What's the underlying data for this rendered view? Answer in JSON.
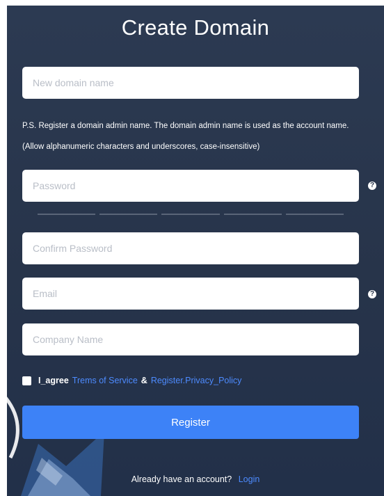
{
  "title": "Create Domain",
  "domain_field": {
    "placeholder": "New domain name"
  },
  "hint_text": "P.S. Register a domain admin name. The domain admin name is used as the account name.(Allow alphanumeric characters and underscores, case-insensitive)",
  "password_field": {
    "placeholder": "Password",
    "help_glyph": "?"
  },
  "password_strength": {
    "segments": 5
  },
  "confirm_password_field": {
    "placeholder": "Confirm Password"
  },
  "email_field": {
    "placeholder": "Email",
    "help_glyph": "?"
  },
  "company_field": {
    "placeholder": "Company Name"
  },
  "agree": {
    "checked": false,
    "label": "I_agree",
    "terms_link": "Trems of Service",
    "separator": "&",
    "privacy_link": "Register.Privacy_Policy"
  },
  "register_button": {
    "label": "Register"
  },
  "footer": {
    "prompt": "Already have an account?",
    "login_link": "Login"
  },
  "colors": {
    "panel_background": "#27344a",
    "primary_button": "#3d82f7",
    "link": "#4d8bff"
  }
}
